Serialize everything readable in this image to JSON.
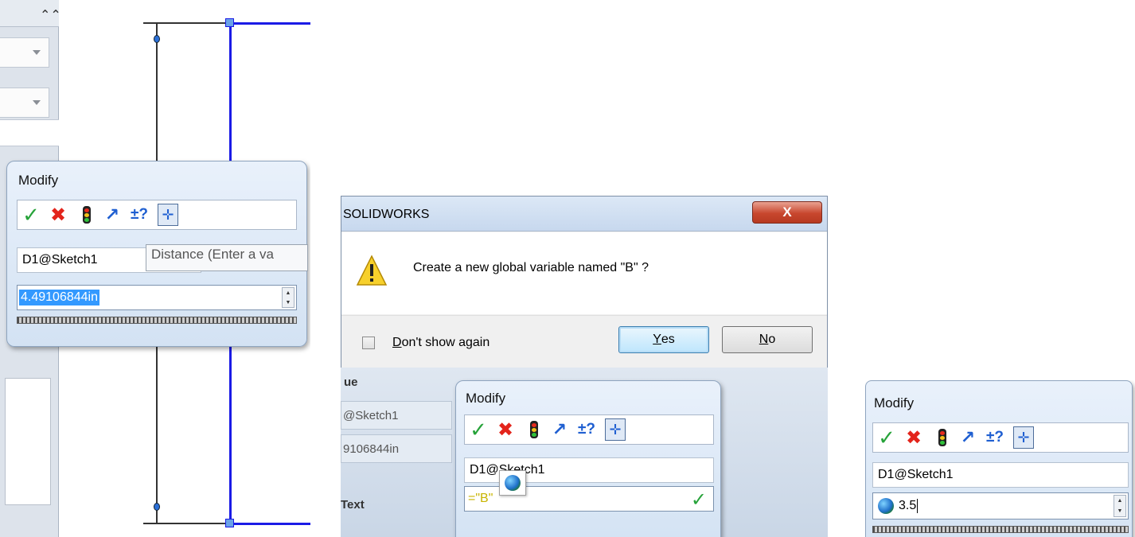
{
  "modify_dialog_1": {
    "title": "Modify",
    "dimension_name": "D1@Sketch1",
    "value": "4.49106844in",
    "tooltip": "Distance (Enter a va"
  },
  "solidworks_dialog": {
    "title": "SOLIDWORKS",
    "close_glyph": "X",
    "message": "Create a new global variable named \"B\" ?",
    "dont_show_label": "Don't show again",
    "yes_label": "Yes",
    "no_label": "No",
    "background_table": {
      "header_fragment": "ue",
      "cell_1": "@Sketch1",
      "cell_2": "9106844in",
      "text_header": "Text"
    }
  },
  "modify_dialog_2": {
    "title": "Modify",
    "dimension_name": "D1@Sketch1",
    "value": "=\"B\""
  },
  "modify_dialog_3": {
    "title": "Modify",
    "dimension_name": "D1@Sketch1",
    "value": "3.5"
  },
  "toolbar_icons": [
    "ok-check-icon",
    "cancel-x-icon",
    "regenerate-light-icon",
    "rebuild-arrow-icon",
    "tolerance-icon",
    "mark-dimension-icon"
  ],
  "colors": {
    "sketch_blue": "#1b1be6",
    "ok_green": "#27a33a",
    "cancel_red": "#e3241b",
    "selection_blue": "#3399ff",
    "variable_yellow": "#c8b400"
  }
}
